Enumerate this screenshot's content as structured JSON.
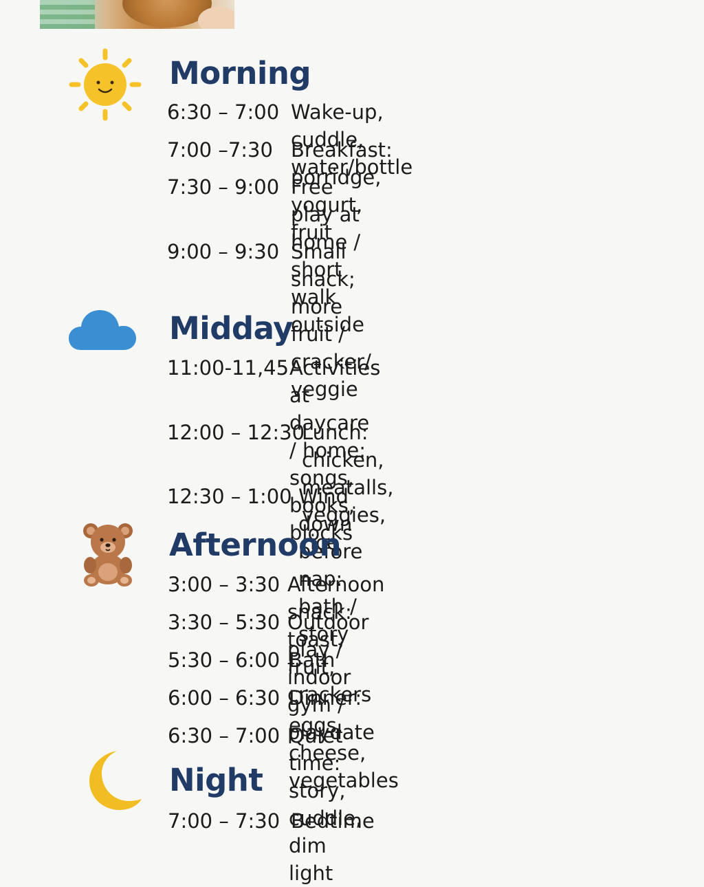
{
  "sections": {
    "morning": {
      "title": "Morning",
      "icon": "sun-icon",
      "color": "#1f3b66",
      "rows": [
        {
          "time": "6:30 – 7:00",
          "activity": "Wake-up, cuddle, water/bottle"
        },
        {
          "time": "7:00 –7:30",
          "activity": "Breakfast: porridge, yogurt, fruit"
        },
        {
          "time": "7:30 – 9:00",
          "activity": "Free play at home / short\nwalk outside"
        },
        {
          "time": "9:00 – 9:30",
          "activity": "Small snack; more fruit / cracker/\nveggie"
        }
      ]
    },
    "midday": {
      "title": "Midday",
      "icon": "cloud-icon",
      "rows": [
        {
          "time": "11:00-11,45",
          "activity": "Activities at daycare / home:\nsongs, books, blocks"
        },
        {
          "time": "12:00 – 12:30",
          "activity": "Lunch: chicken, meatalls, veggies,\nrice"
        },
        {
          "time": "12:30 – 1:00",
          "activity": "Wind down before nap: bath / story"
        }
      ]
    },
    "afternoon": {
      "title": "Afternoon",
      "icon": "teddy-bear-icon",
      "rows": [
        {
          "time": "3:00 – 3:30",
          "activity": "Afternoon snack: toast, fruit, crackers"
        },
        {
          "time": "3:30 – 5:30",
          "activity": "Outdoor play / indoor gym / playdate"
        },
        {
          "time": "5:30 – 6:00",
          "activity": "Bath"
        },
        {
          "time": "6:00 – 6:30",
          "activity": "Dinner: eggs, cheese, vegetables"
        },
        {
          "time": "6:30 – 7:00",
          "activity": "Quiet time: story, cuddle, dim light"
        }
      ]
    },
    "night": {
      "title": "Night",
      "icon": "moon-icon",
      "rows": [
        {
          "time": "7:00 – 7:30",
          "activity": "Bedtime"
        }
      ]
    }
  },
  "colors": {
    "heading": "#1f3b66",
    "sun": "#f5c22a",
    "cloud": "#3a8fd3",
    "moon": "#f2bd22",
    "bear": "#b9774a",
    "background": "#f7f7f5"
  }
}
